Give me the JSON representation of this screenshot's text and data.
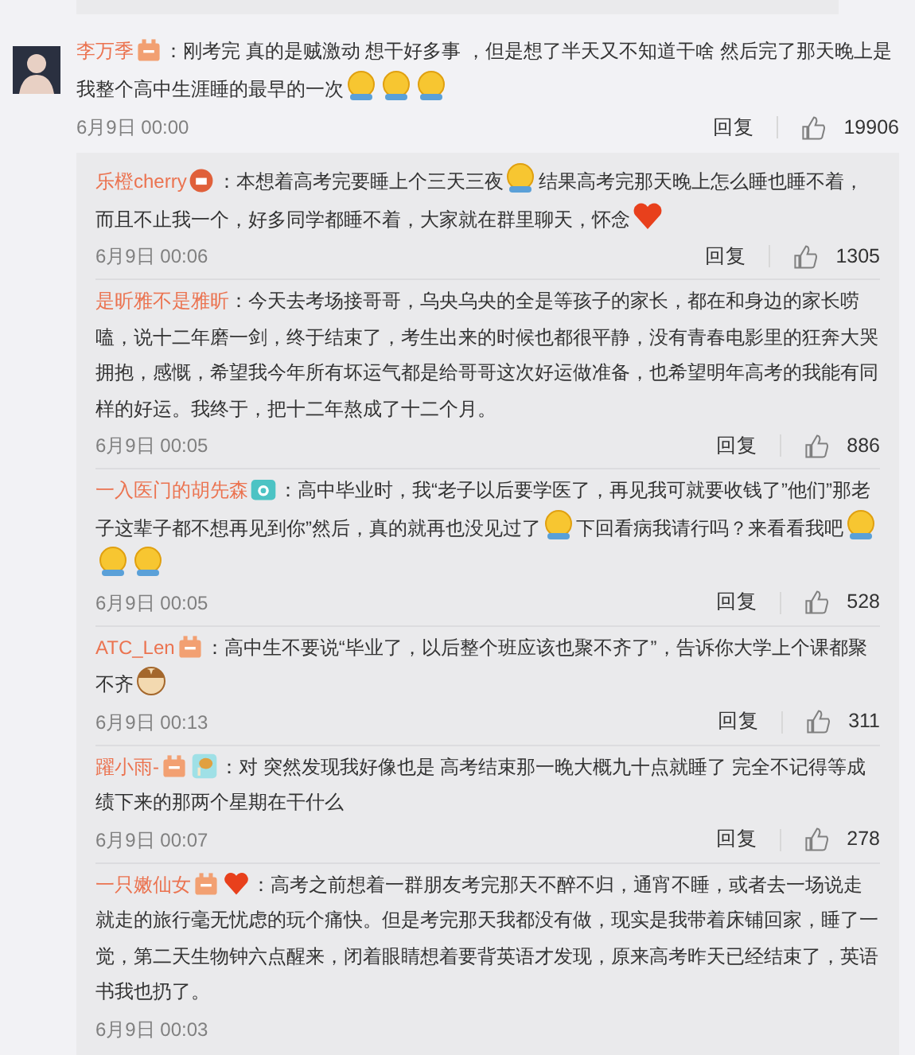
{
  "comment": {
    "user": "李万季",
    "badges": [
      {
        "kind": "vip"
      }
    ],
    "segments": [
      {
        "kind": "text",
        "text": "：刚考完 真的是贼激动 想干好多事 ，但是想了半天又不知道干啥  然后完了那天晚上是我整个高中生涯睡的最早的一次"
      },
      {
        "kind": "face"
      },
      {
        "kind": "face"
      },
      {
        "kind": "face"
      }
    ],
    "time": "6月9日 00:00",
    "reply": "回复",
    "likes": "19906"
  },
  "replies": [
    {
      "user": "乐橙cherry",
      "badges": [
        {
          "kind": "red"
        }
      ],
      "segments": [
        {
          "kind": "text",
          "text": "：本想着高考完要睡上个三天三夜"
        },
        {
          "kind": "face"
        },
        {
          "kind": "text",
          "text": "结果高考完那天晚上怎么睡也睡不着，而且不止我一个，好多同学都睡不着，大家就在群里聊天，怀念"
        },
        {
          "kind": "heart"
        }
      ],
      "time": "6月9日 00:06",
      "reply": "回复",
      "likes": "1305"
    },
    {
      "user": "是昕雅不是雅昕",
      "segments": [
        {
          "kind": "text",
          "text": "：今天去考场接哥哥，乌央乌央的全是等孩子的家长，都在和身边的家长唠嗑，说十二年磨一剑，终于结束了，考生出来的时候也都很平静，没有青春电影里的狂奔大哭拥抱，感慨，希望我今年所有坏运气都是给哥哥这次好运做准备，也希望明年高考的我能有同样的好运。我终于，把十二年熬成了十二个月。"
        }
      ],
      "time": "6月9日 00:05",
      "reply": "回复",
      "likes": "886"
    },
    {
      "user": "一入医门的胡先森",
      "badges": [
        {
          "kind": "camera"
        }
      ],
      "segments": [
        {
          "kind": "text",
          "text": "：高中毕业时，我“老子以后要学医了，再见我可就要收钱了”他们”那老子这辈子都不想再见到你”然后，真的就再也没见过了"
        },
        {
          "kind": "face"
        },
        {
          "kind": "text",
          "text": "下回看病我请行吗？来看看我吧"
        },
        {
          "kind": "face"
        },
        {
          "kind": "face"
        },
        {
          "kind": "face"
        }
      ],
      "time": "6月9日 00:05",
      "reply": "回复",
      "likes": "528"
    },
    {
      "user": "ATC_Len",
      "badges": [
        {
          "kind": "vip"
        }
      ],
      "segments": [
        {
          "kind": "text",
          "text": "：高中生不要说“毕业了，以后整个班应该也聚不齐了”，告诉你大学上个课都聚不齐"
        },
        {
          "kind": "dog"
        }
      ],
      "time": "6月9日 00:13",
      "reply": "回复",
      "likes": "311"
    },
    {
      "user": "躍小雨-",
      "badges": [
        {
          "kind": "vip"
        },
        {
          "kind": "drumstick"
        }
      ],
      "segments": [
        {
          "kind": "text",
          "text": "：对 突然发现我好像也是 高考结束那一晚大概九十点就睡了 完全不记得等成绩下来的那两个星期在干什么"
        }
      ],
      "time": "6月9日 00:07",
      "reply": "回复",
      "likes": "278"
    },
    {
      "user": "一只嫩仙女",
      "badges": [
        {
          "kind": "vip"
        },
        {
          "kind": "heart"
        }
      ],
      "segments": [
        {
          "kind": "text",
          "text": "：高考之前想着一群朋友考完那天不醉不归，通宵不睡，或者去一场说走就走的旅行毫无忧虑的玩个痛快。但是考完那天我都没有做，现实是我带着床铺回家，睡了一觉，第二天生物钟六点醒来，闭着眼睛想着要背英语才发现，原来高考昨天已经结束了，英语书我也扔了。"
        }
      ],
      "time": "6月9日 00:03"
    }
  ]
}
